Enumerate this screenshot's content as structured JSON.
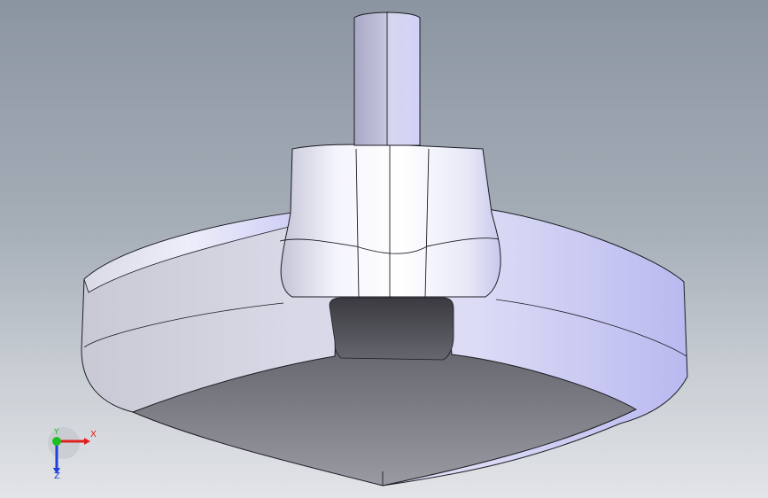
{
  "viewport": {
    "background_top": "#8b95a1",
    "background_bottom": "#e2e4e7",
    "model_color": "#c8c8ee",
    "edge_color": "#1c1c24"
  },
  "triad": {
    "x_label": "X",
    "y_label": "Y",
    "z_label": "Z",
    "x_color": "#e0201c",
    "y_color": "#19c020",
    "z_color": "#2040d8"
  }
}
